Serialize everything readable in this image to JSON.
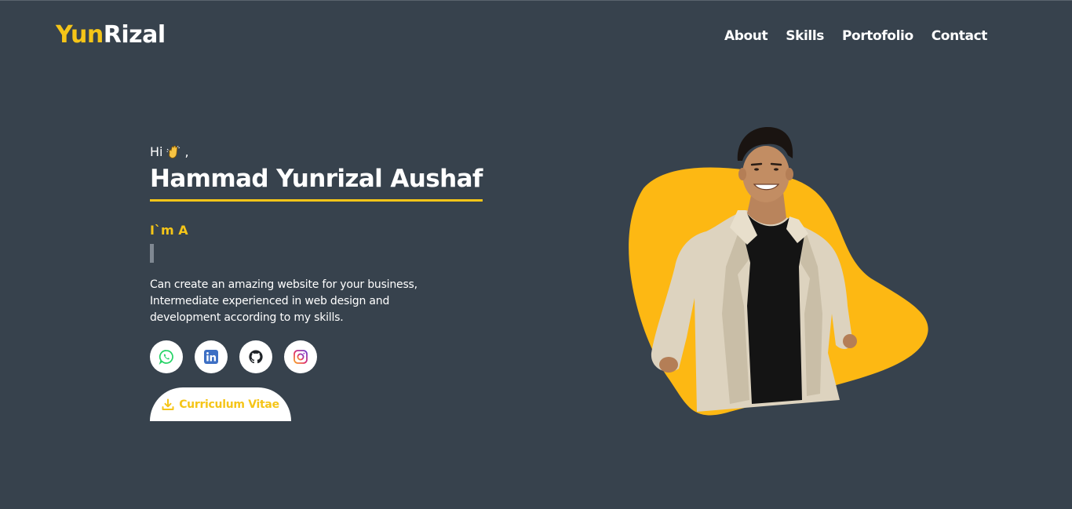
{
  "logo": {
    "part1": "Yun",
    "part2": "Rizal"
  },
  "nav": {
    "about": "About",
    "skills": "Skills",
    "portfolio": "Portofolio",
    "contact": "Contact"
  },
  "hero": {
    "greeting": "Hi",
    "greeting_suffix": ",",
    "name": "Hammad Yunrizal Aushaf",
    "im_a": "I`m A",
    "description": "Can create an amazing website for your business, Intermediate experienced in web design and development according to my skills.",
    "cv_label": "Curriculum Vitae"
  },
  "socials": [
    "whatsapp-icon",
    "linkedin-icon",
    "github-icon",
    "instagram-icon"
  ],
  "colors": {
    "background": "#37424d",
    "accent": "#f5c518",
    "blob": "#fdb813",
    "white": "#ffffff"
  }
}
